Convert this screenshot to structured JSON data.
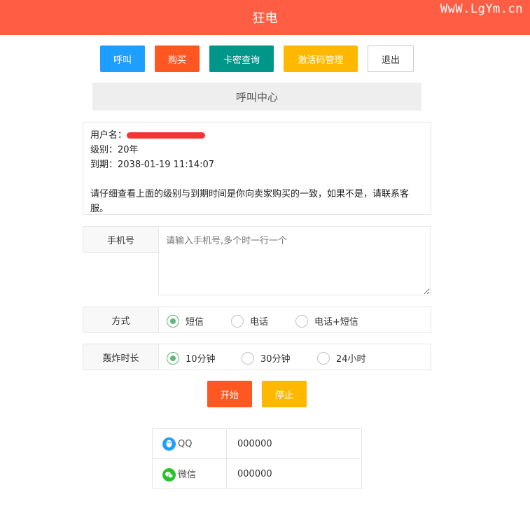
{
  "header": {
    "title": "狂电",
    "watermark": "WwW.LgYm.cn"
  },
  "toolbar": {
    "call": "呼叫",
    "buy": "购买",
    "card_query": "卡密查询",
    "activation": "激活码管理",
    "logout": "退出"
  },
  "section_title": "呼叫中心",
  "info": {
    "username_label": "用户名：",
    "level": "级别：20年",
    "expiry": "到期：2038-01-19 11:14:07",
    "notice": "请仔细查看上面的级别与到期时间是你向卖家购买的一致，如果不是，请联系客服。"
  },
  "form": {
    "phone_label": "手机号",
    "phone_placeholder": "请输入手机号,多个时一行一个",
    "mode_label": "方式",
    "mode_options": [
      "短信",
      "电话",
      "电话+短信"
    ],
    "mode_selected": "短信",
    "duration_label": "轰炸时长",
    "duration_options": [
      "10分钟",
      "30分钟",
      "24小时"
    ],
    "duration_selected": "10分钟",
    "start": "开始",
    "stop": "停止"
  },
  "contact": [
    {
      "label": "QQ",
      "value": "000000",
      "icon": "qq-icon"
    },
    {
      "label": "微信",
      "value": "000000",
      "icon": "wechat-icon"
    }
  ],
  "colors": {
    "header": "#FF5E45",
    "call": "#1E9FFF",
    "buy": "#FF5722",
    "card": "#009688",
    "activation": "#FFB800",
    "radio_checked": "#5FB878"
  }
}
